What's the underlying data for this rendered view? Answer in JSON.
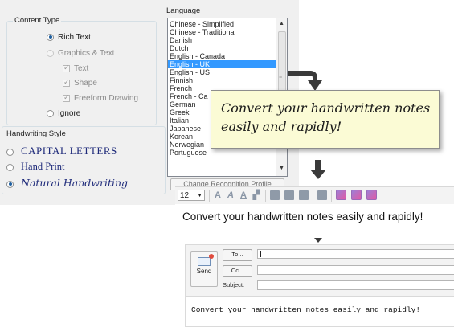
{
  "settings": {
    "content_type": {
      "title": "Content Type",
      "options": {
        "rich_text": "Rich Text",
        "graphics_text": "Graphics & Text",
        "text": "Text",
        "shape": "Shape",
        "freeform": "Freeform Drawing",
        "ignore": "Ignore"
      }
    },
    "handwriting_style": {
      "title": "Handwriting Style",
      "options": {
        "capital": "CAPITAL LETTERS",
        "hand_print": "Hand Print",
        "natural": "Natural Handwriting"
      }
    },
    "language": {
      "title": "Language",
      "items": [
        "Chinese - Simplified",
        "Chinese - Traditional",
        "Danish",
        "Dutch",
        "English - Canada",
        "English - UK",
        "English - US",
        "Finnish",
        "French",
        "French - Ca",
        "German",
        "Greek",
        "Italian",
        "Japanese",
        "Korean",
        "Norwegian",
        "Portuguese"
      ],
      "selected": "English - UK",
      "change_profile_label": "Change Recognition Profile"
    }
  },
  "note": {
    "line1": "Convert your handwritten notes",
    "line2": "easily and rapidly!"
  },
  "toolbar": {
    "font_size": "12"
  },
  "editor": {
    "text": "Convert your handwritten notes easily and rapidly!"
  },
  "email": {
    "send_label": "Send",
    "to_label": "To...",
    "cc_label": "Cc...",
    "subject_label": "Subject:",
    "body": "Convert your handwritten notes easily and rapidly!"
  },
  "colors": {
    "selection": "#3399ff",
    "note_background": "#fbfbd5",
    "arrow": "#3a3a3a"
  }
}
